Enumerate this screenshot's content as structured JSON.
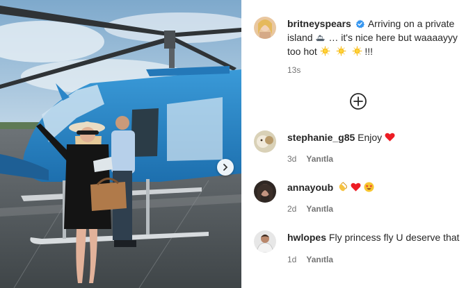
{
  "post": {
    "author": "britneyspears",
    "caption_part1": "Arriving on a private island",
    "caption_part2": "… it's nice here but waaaayyy too hot",
    "caption_part3": "!!!",
    "time": "13s"
  },
  "comments": [
    {
      "user": "stephanie_g85",
      "text": "Enjoy",
      "emojis": [
        "red-heart"
      ],
      "time": "3d",
      "reply_label": "Yanıtla"
    },
    {
      "user": "annayoub",
      "text": "",
      "emojis": [
        "clapping-hands",
        "red-heart",
        "star-struck-face"
      ],
      "time": "2d",
      "reply_label": "Yanıtla"
    },
    {
      "user": "hwlopes",
      "text": "Fly princess fly U deserve that",
      "emojis": [],
      "time": "1d",
      "reply_label": "Yanıtla"
    }
  ],
  "colors": {
    "verified": "#3897f0",
    "heart": "#ed1c24",
    "sky": "#9fc2dd",
    "helicopter_blue": "#2c86c8"
  },
  "icons": [
    "verified-badge-icon",
    "plus-circle-icon",
    "chevron-right-icon",
    "yacht-icon",
    "sun-icon"
  ]
}
